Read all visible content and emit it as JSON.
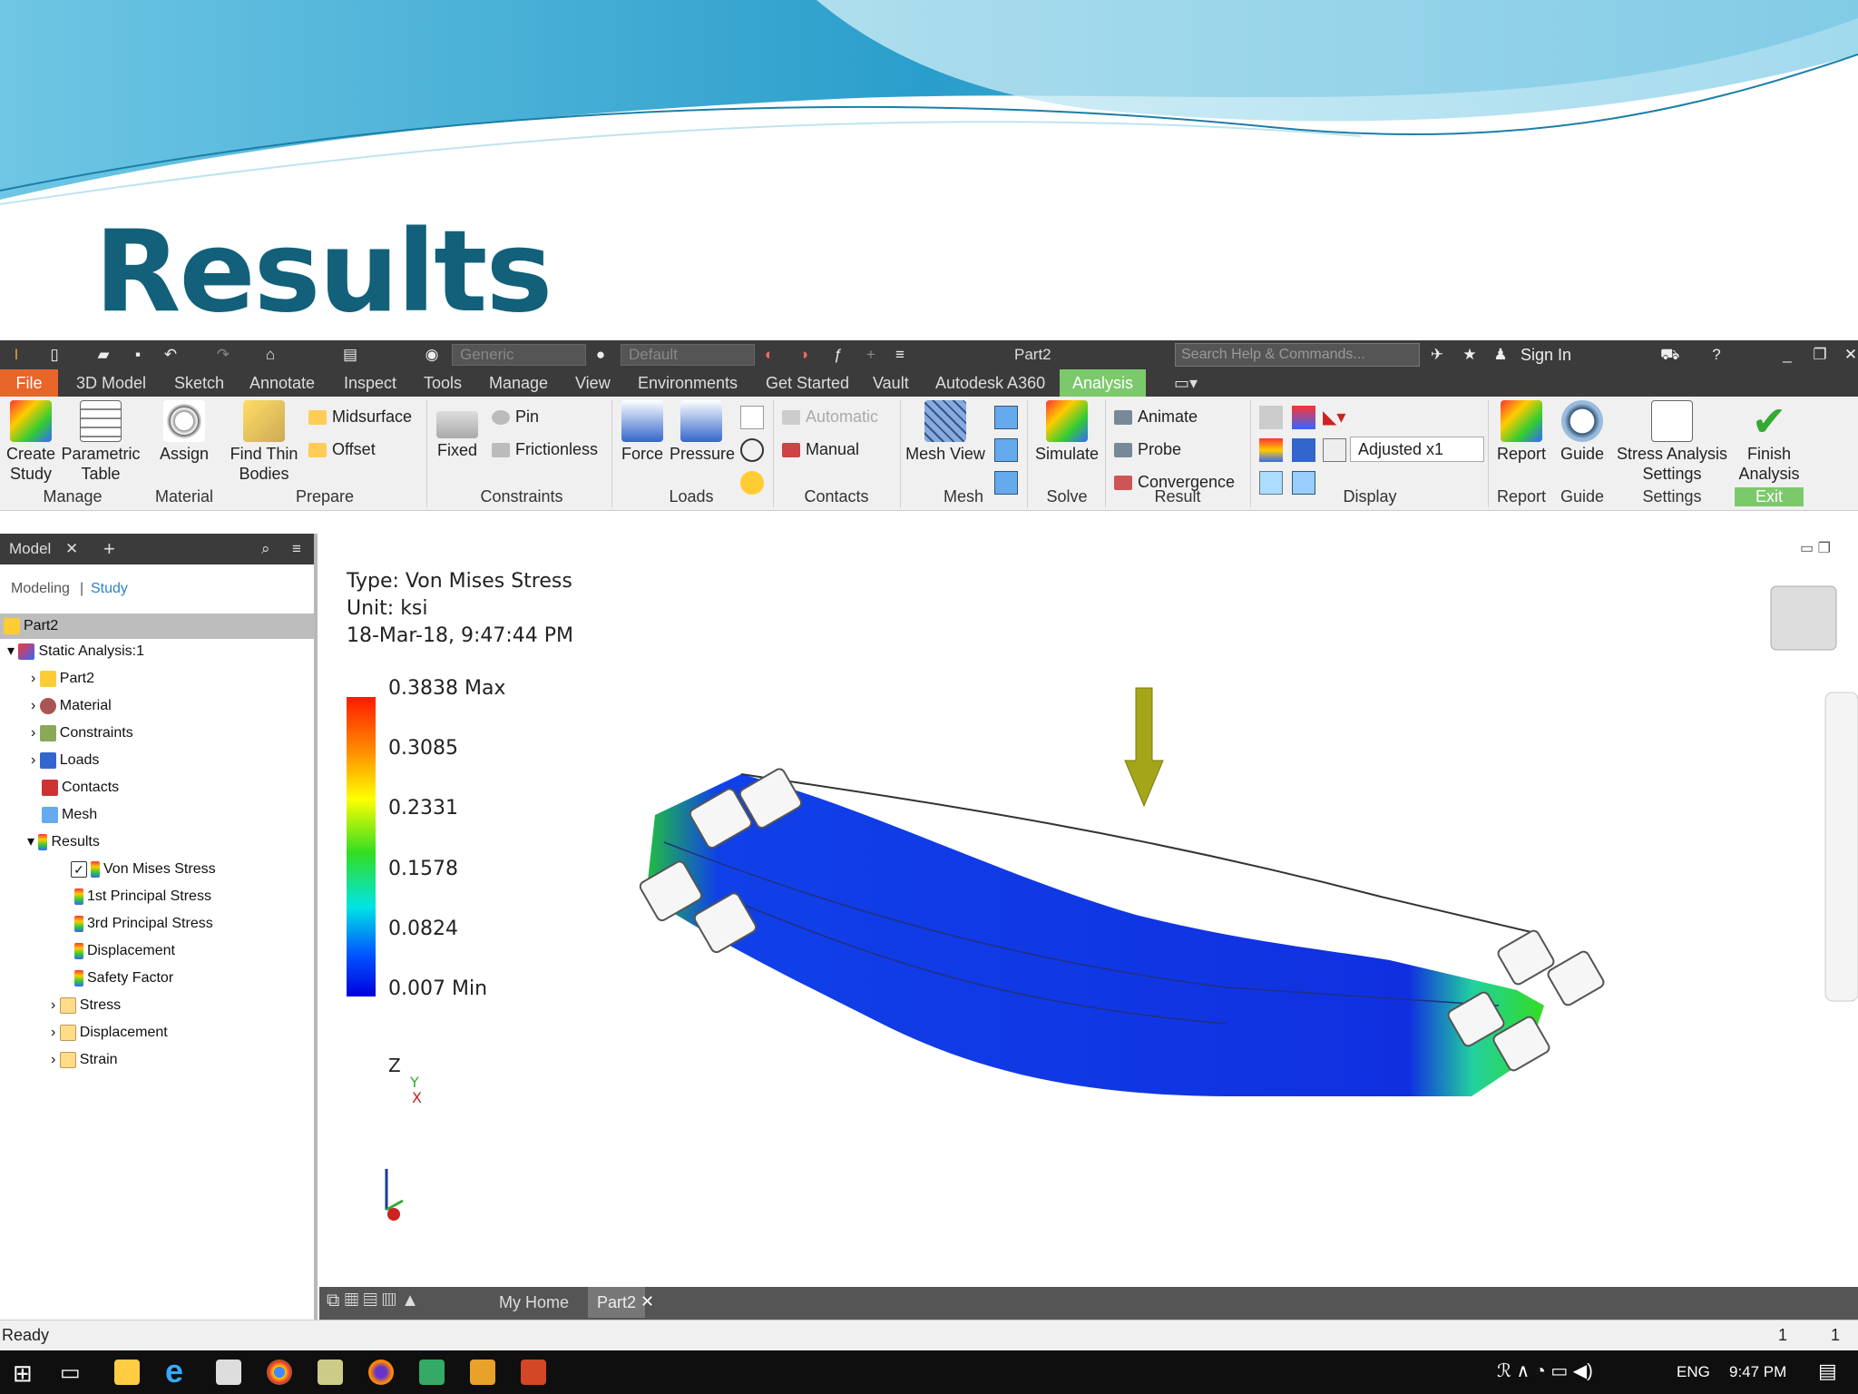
{
  "slide": {
    "title": "Results"
  },
  "quick_access": {
    "material_combo": "Generic",
    "appearance_combo": "Default",
    "doc_title": "Part2",
    "search_placeholder": "Search Help & Commands...",
    "sign_in": "Sign In"
  },
  "tabs": [
    "File",
    "3D Model",
    "Sketch",
    "Annotate",
    "Inspect",
    "Tools",
    "Manage",
    "View",
    "Environments",
    "Get Started",
    "Vault",
    "Autodesk A360",
    "Analysis"
  ],
  "ribbon": {
    "create_study": "Create Study",
    "parametric_table": "Parametric Table",
    "assign": "Assign",
    "find_thin_bodies": "Find Thin Bodies",
    "midsurface": "Midsurface",
    "offset": "Offset",
    "fixed": "Fixed",
    "pin": "Pin",
    "frictionless": "Frictionless",
    "force": "Force",
    "pressure": "Pressure",
    "automatic": "Automatic",
    "manual": "Manual",
    "mesh_view": "Mesh View",
    "simulate": "Simulate",
    "animate": "Animate",
    "probe": "Probe",
    "convergence": "Convergence",
    "adjusted": "Adjusted x1",
    "report": "Report",
    "guide": "Guide",
    "stress_settings": "Stress Analysis Settings",
    "finish_analysis": "Finish Analysis",
    "groups": {
      "manage": "Manage",
      "material": "Material",
      "prepare": "Prepare",
      "constraints": "Constraints",
      "loads": "Loads",
      "contacts": "Contacts",
      "mesh": "Mesh",
      "solve": "Solve",
      "result": "Result",
      "display": "Display",
      "report": "Report",
      "guide": "Guide",
      "settings": "Settings",
      "exit": "Exit"
    }
  },
  "browser": {
    "tab": "Model",
    "modeling": "Modeling",
    "study": "Study",
    "nodes": [
      "Part2",
      "Static Analysis:1",
      "Part2",
      "Material",
      "Constraints",
      "Loads",
      "Contacts",
      "Mesh",
      "Results",
      "Von Mises Stress",
      "1st Principal Stress",
      "3rd Principal Stress",
      "Displacement",
      "Safety Factor",
      "Stress",
      "Displacement",
      "Strain"
    ]
  },
  "viewport": {
    "type": "Type: Von Mises Stress",
    "unit": "Unit: ksi",
    "date": "18-Mar-18, 9:47:44 PM",
    "legend": [
      "0.3838 Max",
      "0.3085",
      "0.2331",
      "0.1578",
      "0.0824",
      "0.007 Min"
    ],
    "axes": {
      "z": "Z",
      "y": "Y",
      "x": "X"
    }
  },
  "doc_tabs": {
    "home": "My Home",
    "part": "Part2"
  },
  "status": {
    "text": "Ready",
    "n1": "1",
    "n2": "1"
  },
  "taskbar": {
    "lang": "ENG",
    "time": "9:47 PM"
  },
  "colors": {
    "title": "#12607a",
    "file_tab": "#e8662a",
    "analysis_tab": "#7cc96c",
    "beam": "#1030e0"
  }
}
